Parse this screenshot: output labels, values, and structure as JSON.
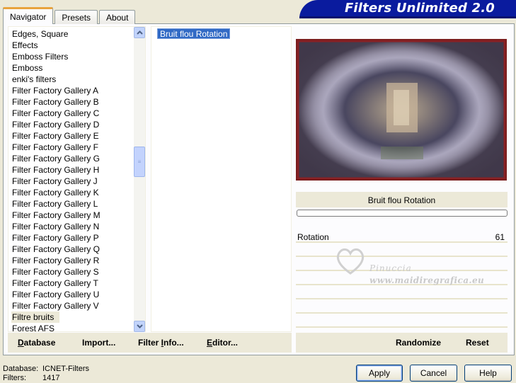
{
  "banner": {
    "title": "Filters Unlimited 2.0"
  },
  "tabs": [
    {
      "label": "Navigator",
      "active": true
    },
    {
      "label": "Presets",
      "active": false
    },
    {
      "label": "About",
      "active": false
    }
  ],
  "categories": [
    "Edges, Square",
    "Effects",
    "Emboss Filters",
    "Emboss",
    "enki's filters",
    "Filter Factory Gallery A",
    "Filter Factory Gallery B",
    "Filter Factory Gallery C",
    "Filter Factory Gallery D",
    "Filter Factory Gallery E",
    "Filter Factory Gallery F",
    "Filter Factory Gallery G",
    "Filter Factory Gallery H",
    "Filter Factory Gallery J",
    "Filter Factory Gallery K",
    "Filter Factory Gallery L",
    "Filter Factory Gallery M",
    "Filter Factory Gallery N",
    "Filter Factory Gallery P",
    "Filter Factory Gallery Q",
    "Filter Factory Gallery R",
    "Filter Factory Gallery S",
    "Filter Factory Gallery T",
    "Filter Factory Gallery U",
    "Filter Factory Gallery V",
    "Filtre bruits",
    "Forest AFS"
  ],
  "selected_category": "Filtre bruits",
  "filters": [
    "Bruit flou Rotation"
  ],
  "preview": {
    "filter_name": "Bruit flou Rotation"
  },
  "params": [
    {
      "label": "Rotation",
      "value": "61"
    }
  ],
  "watermark": {
    "line1": "Pinuccia",
    "line2": "www.maidiregrafica.eu"
  },
  "actions_left": {
    "database": {
      "underlined": "D",
      "rest": "atabase"
    },
    "import": {
      "pre": "Import",
      "underlined": "",
      "rest": "..."
    },
    "filter_info": {
      "pre": "Filter ",
      "underlined": "I",
      "rest": "nfo..."
    },
    "editor": {
      "pre": "",
      "underlined": "E",
      "rest": "ditor..."
    }
  },
  "actions_right": {
    "randomize": "Randomize",
    "reset": "Reset"
  },
  "footer": {
    "database_label": "Database:",
    "database_value": "ICNET-Filters",
    "filters_label": "Filters:",
    "filters_value": "1417"
  },
  "buttons": {
    "apply": "Apply",
    "cancel": "Cancel",
    "help": "Help"
  },
  "colors": {
    "banner": "#0a1b9e",
    "selection": "#316ac5",
    "tab_highlight": "#e8a33e"
  }
}
